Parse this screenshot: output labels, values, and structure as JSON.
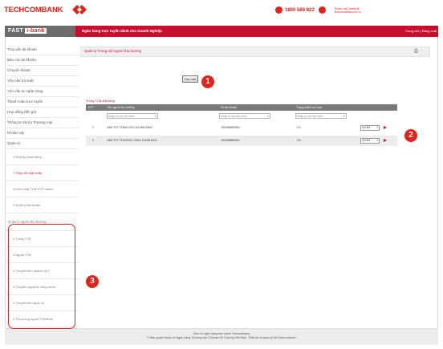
{
  "brand": {
    "name": "TECHCOMBANK",
    "product_main": "FAST",
    "product_sub": "i-bank",
    "tagline": "Ngân hàng trực tuyến dành cho Doanh Nghiệp",
    "hotline": "1800 588 822",
    "contact_lines": [
      "Email: call_center@",
      "techcombank.com.vn"
    ],
    "user_links": "Trang chủ | Đăng xuất"
  },
  "sidebar": {
    "items": [
      "Truy vấn tài khoản",
      "Báo cáo tài khoản",
      "Chuyển khoản",
      "Yêu cầu tra soát",
      "Yêu cầu từ ngân hàng",
      "Thanh toán trực tuyến",
      "Hợp đồng tiền gửi",
      "Thông tin tài trợ thương mại",
      "Khoản vay",
      "Quản trị"
    ],
    "admin_subs": [
      "Nhật ký hoạt động",
      "Thay đổi mật khẩu",
      "Kích hoạt TCB OTP Vasco",
      "Quản lý tài khoản"
    ],
    "beneficiary_group": "Quản lý người thụ hưởng",
    "beneficiary_subs": [
      "Trong TCB",
      "Ngoài TCB",
      "Chuyển tiền nhanh 24/7",
      "Chuyển ngoại tệ trong nước",
      "Chuyển tiền quốc tế",
      "Trả lương ngoài TCB/Bulk"
    ]
  },
  "main": {
    "breadcrumb": "Quản lý Trong nội người thụ hưởng",
    "new_button": "Tạo mới",
    "section_title": "Trong TCB-Đã khớp",
    "columns": [
      "STT",
      "Tên người thụ hưởng",
      "Số tài khoản",
      "Trạng thái/Loại hoạt"
    ],
    "filters": [
      "Nhập từ cần tìm kiếm",
      "Nhập từ cần tìm kiếm",
      "Nhập từ cần tìm kiếm"
    ],
    "rows": [
      {
        "stt": "1",
        "name": "VAN TOT TOAN GIO LAI NHUONG",
        "account": "19029889930x",
        "status": "Có",
        "action": "Chi tiết"
      },
      {
        "stt": "2",
        "name": "VAN TOT THUONG LONG GUAN BCH",
        "account": "19029888930x",
        "status": "Có",
        "action": "Chi tiết"
      }
    ]
  },
  "footer": {
    "line1": "Dịch vụ ngân hàng trực tuyến Techcombank",
    "line2": "© Bản quyền thuộc về Ngân hàng Thương mại Cổ phần Kỹ Thương Việt Nam. Thiết kế và quản lý bởi Techcombank"
  },
  "annotations": {
    "one": "1",
    "two": "2",
    "three": "3"
  },
  "colors": {
    "accent": "#c8102e",
    "brand_red": "#e2231a",
    "header_grey": "#7a7a7a"
  }
}
